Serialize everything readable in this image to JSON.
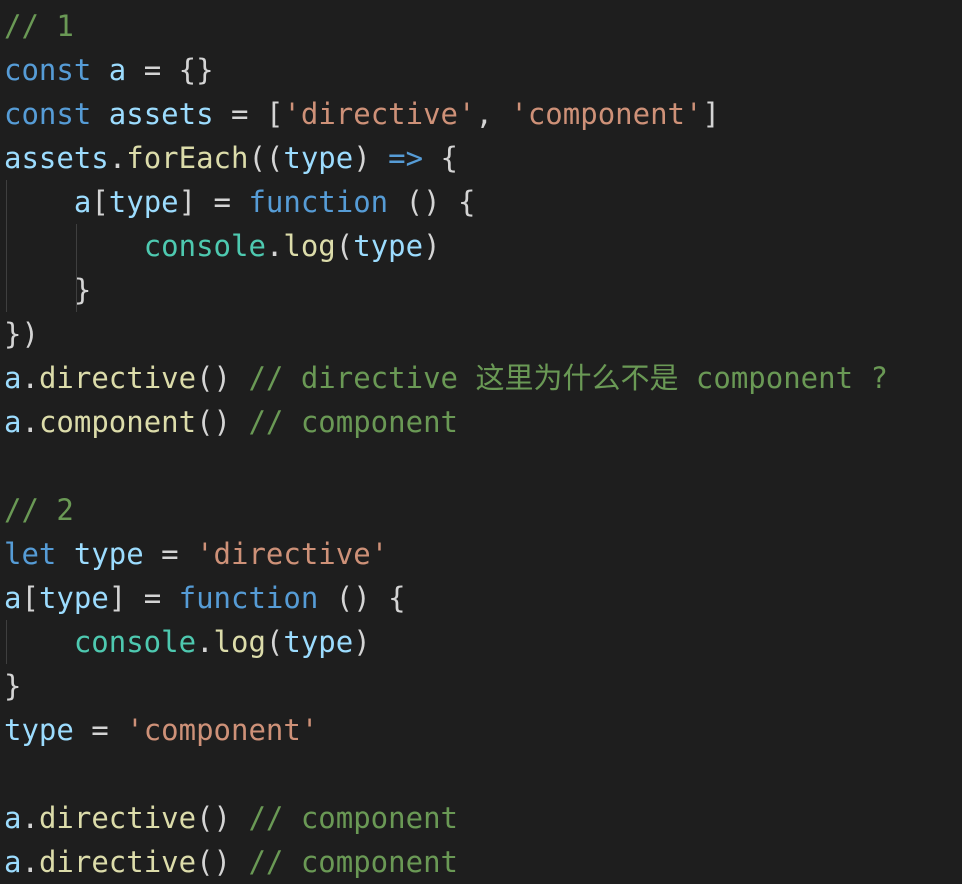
{
  "editor": {
    "language": "javascript",
    "theme": "dark-plus",
    "background_color": "#1e1e1e",
    "colors": {
      "keyword": "#569cd6",
      "variable": "#9cdcfe",
      "string": "#ce9178",
      "comment": "#6a9955",
      "function": "#dcdcaa",
      "class": "#4ec9b0",
      "punctuation": "#d4d4d4",
      "number": "#b5cea8",
      "indent_guide": "#3f3f3f"
    }
  },
  "lines": [
    {
      "n": 1,
      "indent": 0,
      "guides": 0,
      "text": "// 1"
    },
    {
      "n": 2,
      "indent": 0,
      "guides": 0,
      "text": "const a = {}"
    },
    {
      "n": 3,
      "indent": 0,
      "guides": 0,
      "text": "const assets = ['directive', 'component']"
    },
    {
      "n": 4,
      "indent": 0,
      "guides": 0,
      "text": "assets.forEach((type) => {"
    },
    {
      "n": 5,
      "indent": 1,
      "guides": 1,
      "text": "    a[type] = function () {"
    },
    {
      "n": 6,
      "indent": 2,
      "guides": 2,
      "text": "        console.log(type)"
    },
    {
      "n": 7,
      "indent": 1,
      "guides": 2,
      "text": "    }"
    },
    {
      "n": 8,
      "indent": 0,
      "guides": 0,
      "text": "})"
    },
    {
      "n": 9,
      "indent": 0,
      "guides": 0,
      "text": "a.directive() // directive 这里为什么不是 component ?"
    },
    {
      "n": 10,
      "indent": 0,
      "guides": 0,
      "text": "a.component() // component"
    },
    {
      "n": 11,
      "indent": 0,
      "guides": 0,
      "text": ""
    },
    {
      "n": 12,
      "indent": 0,
      "guides": 0,
      "text": "// 2"
    },
    {
      "n": 13,
      "indent": 0,
      "guides": 0,
      "text": "let type = 'directive'"
    },
    {
      "n": 14,
      "indent": 0,
      "guides": 0,
      "text": "a[type] = function () {"
    },
    {
      "n": 15,
      "indent": 1,
      "guides": 1,
      "text": "    console.log(type)"
    },
    {
      "n": 16,
      "indent": 0,
      "guides": 0,
      "text": "}"
    },
    {
      "n": 17,
      "indent": 0,
      "guides": 0,
      "text": "type = 'component'"
    },
    {
      "n": 18,
      "indent": 0,
      "guides": 0,
      "text": ""
    },
    {
      "n": 19,
      "indent": 0,
      "guides": 0,
      "text": "a.directive() // component"
    },
    {
      "n": 20,
      "indent": 0,
      "guides": 0,
      "text": "a.directive() // component"
    }
  ],
  "tokens": {
    "l1": [
      {
        "t": "// 1",
        "c": "com"
      }
    ],
    "l2": [
      {
        "t": "const",
        "c": "kw"
      },
      {
        "t": " ",
        "c": "pun"
      },
      {
        "t": "a",
        "c": "var"
      },
      {
        "t": " = ",
        "c": "pun"
      },
      {
        "t": "{}",
        "c": "pun"
      }
    ],
    "l3": [
      {
        "t": "const",
        "c": "kw"
      },
      {
        "t": " ",
        "c": "pun"
      },
      {
        "t": "assets",
        "c": "var"
      },
      {
        "t": " = ",
        "c": "pun"
      },
      {
        "t": "[",
        "c": "pun"
      },
      {
        "t": "'directive'",
        "c": "str"
      },
      {
        "t": ", ",
        "c": "pun"
      },
      {
        "t": "'component'",
        "c": "str"
      },
      {
        "t": "]",
        "c": "pun"
      }
    ],
    "l4": [
      {
        "t": "assets",
        "c": "var"
      },
      {
        "t": ".",
        "c": "pun"
      },
      {
        "t": "forEach",
        "c": "fn"
      },
      {
        "t": "((",
        "c": "pun"
      },
      {
        "t": "type",
        "c": "var"
      },
      {
        "t": ") ",
        "c": "pun"
      },
      {
        "t": "=>",
        "c": "arrow"
      },
      {
        "t": " {",
        "c": "pun"
      }
    ],
    "l5": [
      {
        "t": "    ",
        "c": "pun"
      },
      {
        "t": "a",
        "c": "var"
      },
      {
        "t": "[",
        "c": "pun"
      },
      {
        "t": "type",
        "c": "var"
      },
      {
        "t": "] = ",
        "c": "pun"
      },
      {
        "t": "function",
        "c": "kw"
      },
      {
        "t": " () {",
        "c": "pun"
      }
    ],
    "l6": [
      {
        "t": "        ",
        "c": "pun"
      },
      {
        "t": "console",
        "c": "cls"
      },
      {
        "t": ".",
        "c": "pun"
      },
      {
        "t": "log",
        "c": "fn"
      },
      {
        "t": "(",
        "c": "pun"
      },
      {
        "t": "type",
        "c": "var"
      },
      {
        "t": ")",
        "c": "pun"
      }
    ],
    "l7": [
      {
        "t": "    }",
        "c": "pun"
      }
    ],
    "l8": [
      {
        "t": "})",
        "c": "pun"
      }
    ],
    "l9": [
      {
        "t": "a",
        "c": "var"
      },
      {
        "t": ".",
        "c": "pun"
      },
      {
        "t": "directive",
        "c": "fn"
      },
      {
        "t": "() ",
        "c": "pun"
      },
      {
        "t": "// directive 这里为什么不是 component ?",
        "c": "com"
      }
    ],
    "l10": [
      {
        "t": "a",
        "c": "var"
      },
      {
        "t": ".",
        "c": "pun"
      },
      {
        "t": "component",
        "c": "fn"
      },
      {
        "t": "() ",
        "c": "pun"
      },
      {
        "t": "// component",
        "c": "com"
      }
    ],
    "l11": [],
    "l12": [
      {
        "t": "// 2",
        "c": "com"
      }
    ],
    "l13": [
      {
        "t": "let",
        "c": "kw"
      },
      {
        "t": " ",
        "c": "pun"
      },
      {
        "t": "type",
        "c": "var"
      },
      {
        "t": " = ",
        "c": "pun"
      },
      {
        "t": "'directive'",
        "c": "str"
      }
    ],
    "l14": [
      {
        "t": "a",
        "c": "var"
      },
      {
        "t": "[",
        "c": "pun"
      },
      {
        "t": "type",
        "c": "var"
      },
      {
        "t": "] = ",
        "c": "pun"
      },
      {
        "t": "function",
        "c": "kw"
      },
      {
        "t": " () {",
        "c": "pun"
      }
    ],
    "l15": [
      {
        "t": "    ",
        "c": "pun"
      },
      {
        "t": "console",
        "c": "cls"
      },
      {
        "t": ".",
        "c": "pun"
      },
      {
        "t": "log",
        "c": "fn"
      },
      {
        "t": "(",
        "c": "pun"
      },
      {
        "t": "type",
        "c": "var"
      },
      {
        "t": ")",
        "c": "pun"
      }
    ],
    "l16": [
      {
        "t": "}",
        "c": "pun"
      }
    ],
    "l17": [
      {
        "t": "type",
        "c": "var"
      },
      {
        "t": " = ",
        "c": "pun"
      },
      {
        "t": "'component'",
        "c": "str"
      }
    ],
    "l18": [],
    "l19": [
      {
        "t": "a",
        "c": "var"
      },
      {
        "t": ".",
        "c": "pun"
      },
      {
        "t": "directive",
        "c": "fn"
      },
      {
        "t": "() ",
        "c": "pun"
      },
      {
        "t": "// component",
        "c": "com"
      }
    ],
    "l20": [
      {
        "t": "a",
        "c": "var"
      },
      {
        "t": ".",
        "c": "pun"
      },
      {
        "t": "directive",
        "c": "fn"
      },
      {
        "t": "() ",
        "c": "pun"
      },
      {
        "t": "// component",
        "c": "com"
      }
    ]
  }
}
